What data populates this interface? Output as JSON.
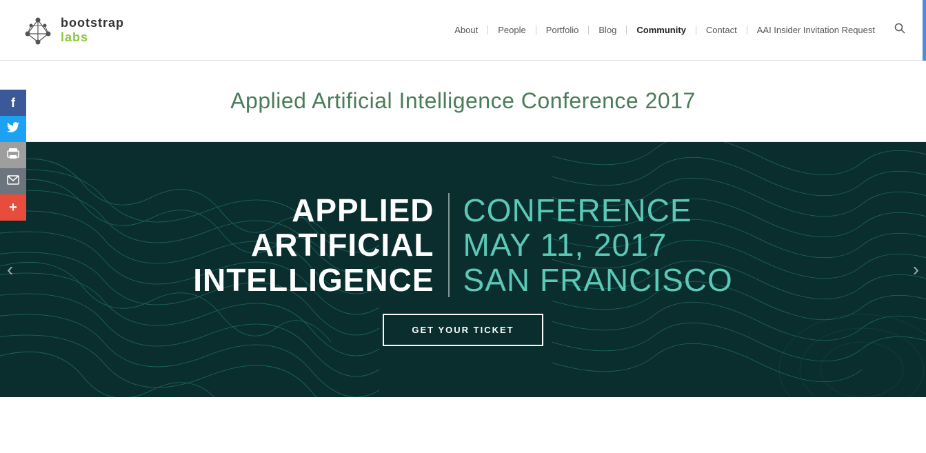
{
  "header": {
    "logo_bootstrap": "bootstrap",
    "logo_labs": "labs",
    "nav_items": [
      {
        "label": "About",
        "active": false
      },
      {
        "label": "People",
        "active": false
      },
      {
        "label": "Portfolio",
        "active": false
      },
      {
        "label": "Blog",
        "active": false
      },
      {
        "label": "Community",
        "active": true
      },
      {
        "label": "Contact",
        "active": false
      },
      {
        "label": "AAI Insider Invitation Request",
        "active": false
      }
    ]
  },
  "social": {
    "facebook_icon": "f",
    "twitter_icon": "🐦",
    "print_icon": "🖨",
    "email_icon": "✉",
    "more_icon": "+"
  },
  "page_title": "Applied Artificial Intelligence Conference 2017",
  "hero": {
    "left_line1": "APPLIED",
    "left_line2": "ARTIFICIAL",
    "left_line3": "INTELLIGENCE",
    "right_line1": "CONFERENCE",
    "right_line2": "MAY 11, 2017",
    "right_line3": "SAN FRANCISCO",
    "cta_label": "GET YOUR TICKET"
  }
}
